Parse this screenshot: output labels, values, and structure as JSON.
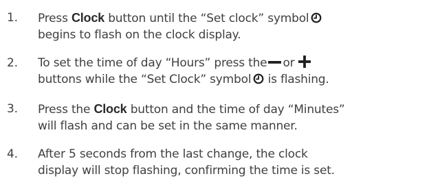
{
  "steps": [
    {
      "number": "1.",
      "line1_pre": "Press ",
      "line1_bold": "Clock",
      "line1_post": " button until the “Set clock” symbol",
      "line2": "begins to flash on the clock display."
    },
    {
      "number": "2.",
      "line1_pre": "To set the time of day “Hours” press the",
      "line1_mid": "or",
      "line2_pre": "buttons while the “Set Clock” symbol",
      "line2_post": "is flashing."
    },
    {
      "number": "3.",
      "line1_pre": "Press the ",
      "line1_bold": "Clock",
      "line1_post": " button and the time of day “Minutes”",
      "line2": "will flash and can be set in the same manner."
    },
    {
      "number": "4.",
      "line1": "After 5 seconds from the last change, the clock",
      "line2": "display will stop flashing, confirming the time is set."
    }
  ],
  "icons": {
    "set_clock_symbol": "clock-icon",
    "minus_button": "minus-icon",
    "plus_button": "plus-icon"
  },
  "colors": {
    "text": "#3f3f3f",
    "bold_text": "#2a2a2a",
    "icon": "#1f1f1f"
  }
}
